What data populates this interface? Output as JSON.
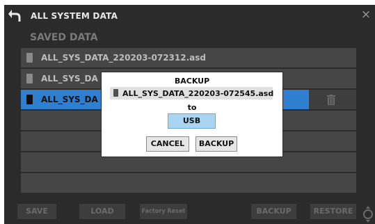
{
  "header": {
    "title": "ALL SYSTEM DATA",
    "close_glyph": "×"
  },
  "section_title": "SAVED DATA",
  "list": {
    "rows": [
      {
        "name": "ALL_SYS_DATA_220203-072312.asd",
        "selected": false
      },
      {
        "name": "ALL_SYS_DA",
        "selected": false
      },
      {
        "name": "ALL_SYS_DA",
        "selected": true
      }
    ],
    "empty_rows": 4
  },
  "footer": {
    "save": "SAVE",
    "load": "LOAD",
    "factory_reset": "Factory Reset",
    "backup": "BACKUP",
    "restore": "RESTORE"
  },
  "dialog": {
    "title": "BACKUP",
    "file": "ALL_SYS_DATA_220203-072545.asd",
    "to_label": "to",
    "destination": "USB",
    "cancel": "CANCEL",
    "confirm": "BACKUP"
  },
  "colors": {
    "background": "#2b2b2b",
    "row": "#464646",
    "selected_row": "#2f7fd1",
    "usb_button": "#a9d4f2"
  }
}
